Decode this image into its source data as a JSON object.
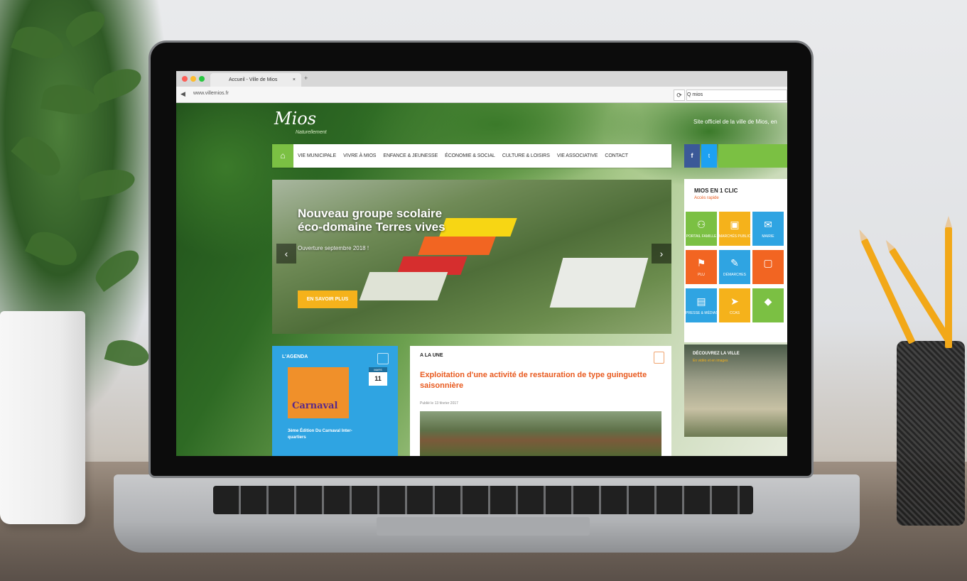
{
  "browser": {
    "tab_title": "Accueil - Ville de Mios",
    "tab_close": "×",
    "new_tab": "+",
    "url": "www.villemios.fr",
    "reload_icon": "⟳",
    "search_value": "Q  mios"
  },
  "site": {
    "logo": "Mios",
    "logo_sub": "Naturellement",
    "tagline": "Site officiel de la ville de Mios, en",
    "nav": {
      "home_icon": "⌂",
      "items": [
        "VIE MUNICIPALE",
        "VIVRE À MIOS",
        "ENFANCE & JEUNESSE",
        "ÉCONOMIE & SOCIAL",
        "CULTURE & LOISIRS",
        "VIE ASSOCIATIVE",
        "CONTACT"
      ]
    },
    "social": {
      "facebook": "f",
      "twitter": "t"
    },
    "hero": {
      "title_line1": "Nouveau groupe scolaire",
      "title_line2": "éco-domaine Terres vives",
      "subtitle": "Ouverture septembre 2018 !",
      "button": "EN SAVOIR PLUS",
      "prev": "‹",
      "next": "›"
    },
    "clic": {
      "title": "MIOS EN 1 CLIC",
      "subtitle": "Accès rapide",
      "tiles": [
        {
          "label": "PORTAIL FAMILLE",
          "icon": "⚇",
          "color": "#7bc043"
        },
        {
          "label": "MARCHÉS PUBLICS",
          "icon": "▣",
          "color": "#f5b21b"
        },
        {
          "label": "MAIRIE",
          "icon": "✉",
          "color": "#2fa4e2"
        },
        {
          "label": "PLU",
          "icon": "⚑",
          "color": "#f26522"
        },
        {
          "label": "DÉMARCHES",
          "icon": "✎",
          "color": "#2fa4e2"
        },
        {
          "label": "",
          "icon": "▢",
          "color": "#f26522"
        },
        {
          "label": "PRESSE & MÉDIAS",
          "icon": "▤",
          "color": "#2fa4e2"
        },
        {
          "label": "CCAS",
          "icon": "➤",
          "color": "#f5b21b"
        },
        {
          "label": "",
          "icon": "◆",
          "color": "#7bc043"
        }
      ]
    },
    "agenda": {
      "title": "L'AGENDA",
      "event_image_text": "Carnaval",
      "date_month": "MARS",
      "date_day": "11",
      "event_caption": "3ème Édition Du Carnaval Inter-quartiers"
    },
    "a_la_une": {
      "title": "A LA UNE",
      "headline": "Exploitation d'une activité de restauration de type guinguette saisonnière",
      "date": "Publié le 13 février 2017"
    },
    "decouvrez": {
      "title": "DÉCOUVREZ LA VILLE",
      "subtitle": "En vidéo et en images"
    }
  }
}
